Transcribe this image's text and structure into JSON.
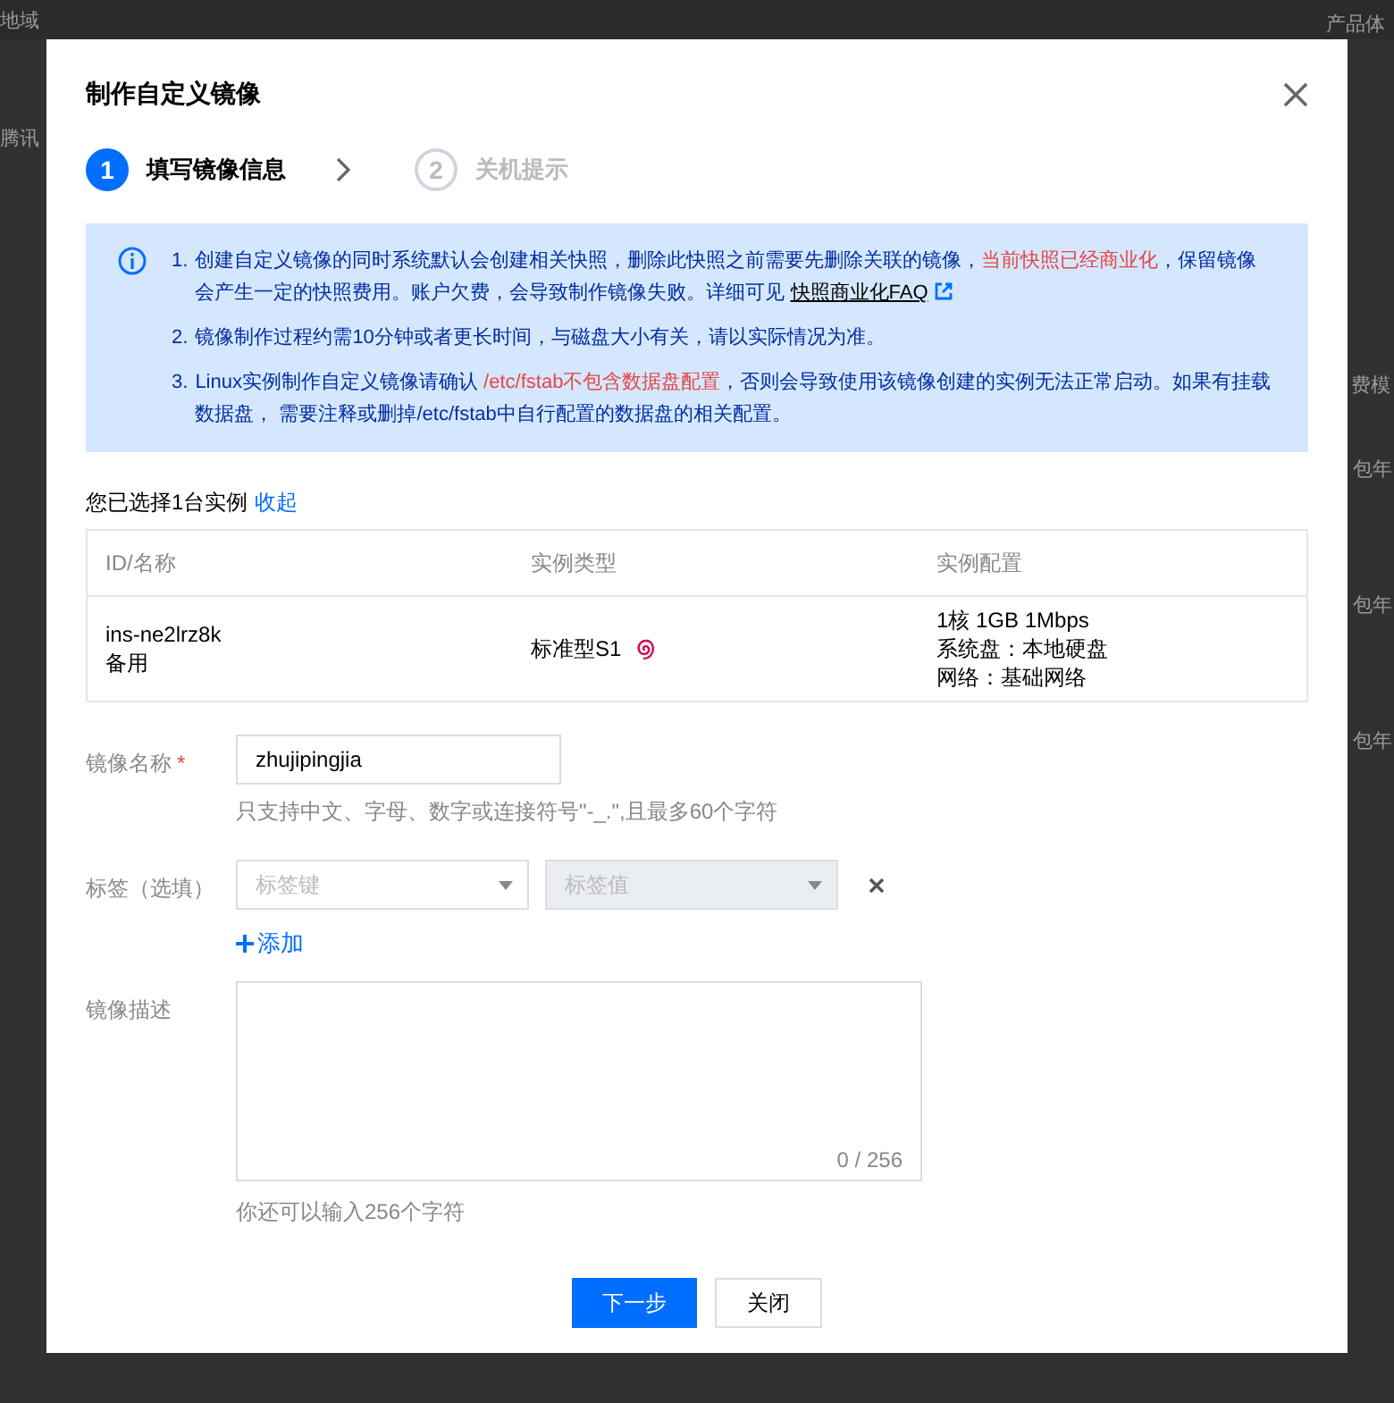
{
  "background": {
    "texts": [
      "地域",
      "产品体",
      "腾讯",
      "费模",
      "包年",
      "包年",
      "包年"
    ]
  },
  "dialog": {
    "title": "制作自定义镜像"
  },
  "steps": [
    {
      "number": "1",
      "label": "填写镜像信息",
      "selected": true
    },
    {
      "number": "2",
      "label": "关机提示",
      "selected": false
    }
  ],
  "alert": {
    "items": [
      {
        "number": "1.",
        "parts": [
          {
            "kind": "plain",
            "text": "创建自定义镜像的同时系统默认会创建相关快照，删除此快照之前需要先删除关联的镜像，"
          },
          {
            "kind": "warn",
            "text": "当前快照已经商业化"
          },
          {
            "kind": "plain",
            "text": "，保留镜像会产生一定的快照费用。账户欠费，会导致制作镜像失败。详细可见 "
          },
          {
            "kind": "link",
            "text": "快照商业化FAQ"
          }
        ]
      },
      {
        "number": "2.",
        "parts": [
          {
            "kind": "plain",
            "text": "镜像制作过程约需10分钟或者更长时间，与磁盘大小有关，请以实际情况为准。"
          }
        ]
      },
      {
        "number": "3.",
        "parts": [
          {
            "kind": "plain",
            "text": "Linux实例制作自定义镜像请确认 "
          },
          {
            "kind": "warn",
            "text": "/etc/fstab不包含数据盘配置"
          },
          {
            "kind": "plain",
            "text": "，否则会导致使用该镜像创建的实例无法正常启动。如果有挂载数据盘， 需要注释或删掉/etc/fstab中自行配置的数据盘的相关配置。"
          }
        ]
      }
    ]
  },
  "selection": {
    "text": "您已选择1台实例",
    "toggle": "收起"
  },
  "table": {
    "columns": [
      "ID/名称",
      "实例类型",
      "实例配置"
    ],
    "rows": [
      {
        "id": "ins-ne2lrz8k",
        "name": "备用",
        "type": "标准型S1",
        "config": [
          "1核 1GB 1Mbps",
          "系统盘：本地硬盘",
          "网络：基础网络"
        ]
      }
    ]
  },
  "form": {
    "name": {
      "label": "镜像名称",
      "required": true,
      "required_mark": "*",
      "value": "zhujipingjia",
      "hint": "只支持中文、字母、数字或连接符号\"-_.\",且最多60个字符"
    },
    "tags": {
      "label": "标签（选填）",
      "key_placeholder": "标签键",
      "value_placeholder": "标签值",
      "value_disabled": true,
      "add": "添加"
    },
    "description": {
      "label": "镜像描述",
      "counter": "0 / 256",
      "hint": "你还可以输入256个字符"
    }
  },
  "buttons": [
    {
      "label": "下一步",
      "kind": "primary"
    },
    {
      "label": "关闭",
      "kind": "default"
    }
  ]
}
